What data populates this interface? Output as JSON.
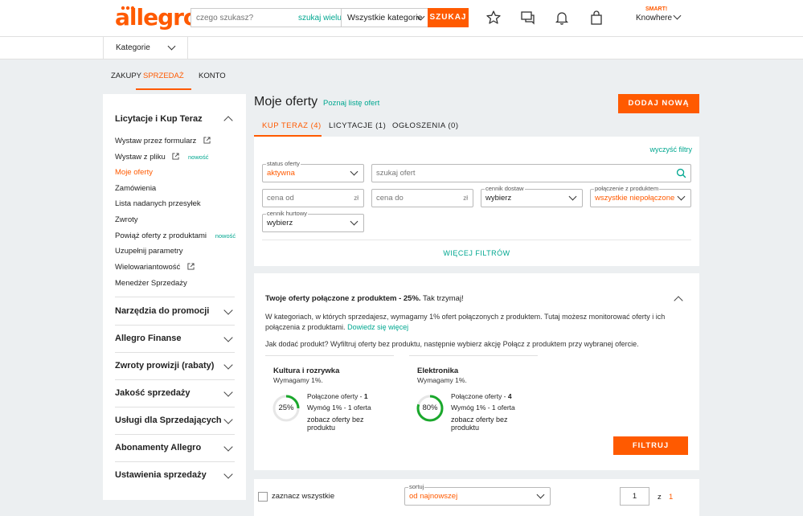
{
  "header": {
    "logo": "allegro",
    "search_placeholder": "czego szukasz?",
    "search_many": "szukaj wielu",
    "category": "Wszystkie kategorie",
    "search_button": "SZUKAJ",
    "smart": "SMART!",
    "user": "Knowhere"
  },
  "subbar": {
    "categories": "Kategorie"
  },
  "top_tabs": [
    "ZAKUPY",
    "SPRZEDAŻ",
    "KONTO"
  ],
  "sidebar": {
    "section_title": "Licytacje i Kup Teraz",
    "items": [
      {
        "label": "Wystaw przez formularz",
        "badge": ""
      },
      {
        "label": "Wystaw z pliku",
        "badge": "nowość"
      },
      {
        "label": "Moje oferty",
        "badge": ""
      },
      {
        "label": "Zamówienia",
        "badge": ""
      },
      {
        "label": "Lista nadanych przesyłek",
        "badge": ""
      },
      {
        "label": "Zwroty",
        "badge": ""
      },
      {
        "label": "Powiąż oferty z produktami",
        "badge": "nowość"
      },
      {
        "label": "Uzupełnij parametry",
        "badge": ""
      },
      {
        "label": "Wielowariantowość",
        "badge": ""
      },
      {
        "label": "Menedżer Sprzedaży",
        "badge": ""
      }
    ],
    "sections": [
      "Narzędzia do promocji",
      "Allegro Finanse",
      "Zwroty prowizji (rabaty)",
      "Jakość sprzedaży",
      "Usługi dla Sprzedających",
      "Abonamenty Allegro",
      "Ustawienia sprzedaży"
    ]
  },
  "main": {
    "title": "Moje oferty",
    "learn_link": "Poznaj listę ofert",
    "add_button": "DODAJ NOWĄ",
    "tabs": [
      "KUP TERAZ (4)",
      "LICYTACJE (1)",
      "OGŁOSZENIA (0)"
    ]
  },
  "filters": {
    "clear": "wyczyść filtry",
    "status_label": "status oferty",
    "status_value": "aktywna",
    "search_placeholder": "szukaj ofert",
    "price_from": "cena od",
    "price_to": "cena do",
    "currency": "zł",
    "delivery_label": "cennik dostaw",
    "delivery_value": "wybierz",
    "product_label": "połączenie z produktem",
    "product_value": "wszystkie niepołączone",
    "wholesale_label": "cennik hurtowy",
    "wholesale_value": "wybierz",
    "more": "WIĘCEJ FILTRÓW"
  },
  "promo": {
    "title_bold": "Twoje oferty połączone z produktem - 25%.",
    "title_rest": "Tak trzymaj!",
    "text1": "W kategoriach, w których sprzedajesz, wymagamy 1% ofert połączonych z produktem. Tutaj możesz monitorować oferty i ich połączenia z produktami.",
    "text1_link": "Dowiedz się więcej",
    "text2": "Jak dodać produkt? Wyfiltruj oferty bez produktu, następnie wybierz akcję Połącz z produktem przy wybranej ofercie.",
    "categories": [
      {
        "name": "Kultura i rozrywka",
        "req": "Wymagamy 1%.",
        "percent": 25,
        "percent_label": "25%",
        "connected_label": "Połączone oferty - ",
        "connected": "1",
        "req_line": "Wymóg 1% - 1 oferta",
        "link": "zobacz oferty bez produktu"
      },
      {
        "name": "Elektronika",
        "req": "Wymagamy 1%.",
        "percent": 80,
        "percent_label": "80%",
        "connected_label": "Połączone oferty - ",
        "connected": "4",
        "req_line": "Wymóg 1% - 1 oferta",
        "link": "zobacz oferty bez produktu"
      }
    ],
    "filter_button": "FILTRUJ OFERTY"
  },
  "bottom": {
    "select_all": "zaznacz wszystkie",
    "sort_label": "sortuj",
    "sort_value": "od najnowszej",
    "page": "1",
    "of": "z",
    "total": "1"
  },
  "colors": {
    "accent": "#ff5a00",
    "link": "#00a790",
    "ring": "#1aa82c"
  }
}
